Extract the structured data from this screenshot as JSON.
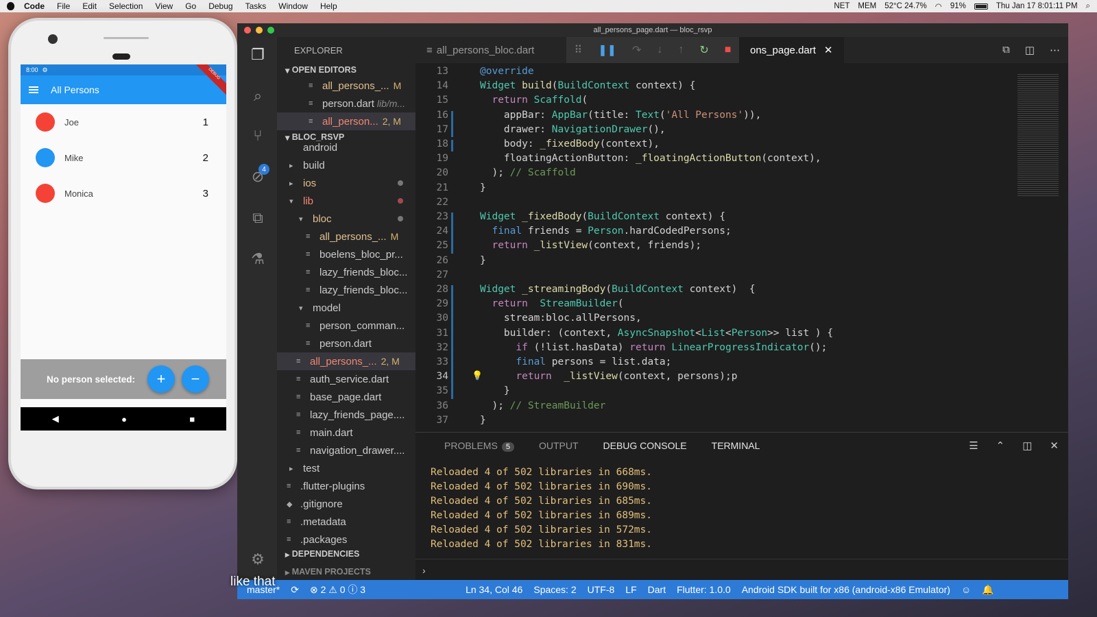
{
  "menubar": {
    "app": "Code",
    "items": [
      "File",
      "Edit",
      "Selection",
      "View",
      "Go",
      "Debug",
      "Tasks",
      "Window",
      "Help"
    ],
    "status": {
      "net": "NET",
      "mem": "MEM",
      "temp": "52°C 24.7%",
      "battery": "91%",
      "clock": "Thu Jan 17  8:01:11 PM"
    }
  },
  "phone": {
    "status_time": "8:00",
    "app_title": "All Persons",
    "persons": [
      {
        "name": "Joe",
        "num": "1",
        "color": "#f44336"
      },
      {
        "name": "Mike",
        "num": "2",
        "color": "#2196f3"
      },
      {
        "name": "Monica",
        "num": "3",
        "color": "#f44336"
      }
    ],
    "bottom_label": "No person selected:",
    "add_label": "+",
    "remove_label": "−"
  },
  "vscode": {
    "window_title": "all_persons_page.dart — bloc_rsvp",
    "explorer_title": "EXPLORER",
    "open_editors_title": "OPEN EDITORS",
    "project_title": "BLOC_RSVP",
    "dependencies_title": "DEPENDENCIES",
    "maven_title": "MAVEN PROJECTS",
    "open_editors": [
      {
        "label": "all_persons_...",
        "suffix": "M",
        "cls": "gold"
      },
      {
        "label": "person.dart",
        "suffix": "lib/m...",
        "cls": ""
      },
      {
        "label": "all_person...",
        "suffix": "2, M",
        "cls": "red"
      }
    ],
    "tree": [
      {
        "indent": 10,
        "icon": "",
        "label": "android",
        "cls": ""
      },
      {
        "indent": 10,
        "icon": "▸",
        "label": "build",
        "cls": ""
      },
      {
        "indent": 10,
        "icon": "▸",
        "label": "ios",
        "cls": "gold",
        "dot": true
      },
      {
        "indent": 10,
        "icon": "▾",
        "label": "lib",
        "cls": "red",
        "dot": true
      },
      {
        "indent": 24,
        "icon": "▾",
        "label": "bloc",
        "cls": "gold",
        "dot": true
      },
      {
        "indent": 34,
        "icon": "≡",
        "label": "all_persons_...",
        "cls": "gold",
        "mod": "M"
      },
      {
        "indent": 34,
        "icon": "≡",
        "label": "boelens_bloc_pr...",
        "cls": ""
      },
      {
        "indent": 34,
        "icon": "≡",
        "label": "lazy_friends_bloc...",
        "cls": ""
      },
      {
        "indent": 34,
        "icon": "≡",
        "label": "lazy_friends_bloc...",
        "cls": ""
      },
      {
        "indent": 24,
        "icon": "▾",
        "label": "model",
        "cls": ""
      },
      {
        "indent": 34,
        "icon": "≡",
        "label": "person_comman...",
        "cls": ""
      },
      {
        "indent": 34,
        "icon": "≡",
        "label": "person.dart",
        "cls": ""
      },
      {
        "indent": 20,
        "icon": "≡",
        "label": "all_persons_...",
        "cls": "red",
        "mod": "2, M",
        "sel": true
      },
      {
        "indent": 20,
        "icon": "≡",
        "label": "auth_service.dart",
        "cls": ""
      },
      {
        "indent": 20,
        "icon": "≡",
        "label": "base_page.dart",
        "cls": ""
      },
      {
        "indent": 20,
        "icon": "≡",
        "label": "lazy_friends_page....",
        "cls": ""
      },
      {
        "indent": 20,
        "icon": "≡",
        "label": "main.dart",
        "cls": ""
      },
      {
        "indent": 20,
        "icon": "≡",
        "label": "navigation_drawer....",
        "cls": ""
      },
      {
        "indent": 10,
        "icon": "▸",
        "label": "test",
        "cls": ""
      },
      {
        "indent": 6,
        "icon": "≡",
        "label": ".flutter-plugins",
        "cls": ""
      },
      {
        "indent": 6,
        "icon": "◆",
        "label": ".gitignore",
        "cls": ""
      },
      {
        "indent": 6,
        "icon": "≡",
        "label": ".metadata",
        "cls": ""
      },
      {
        "indent": 6,
        "icon": "≡",
        "label": ".packages",
        "cls": ""
      }
    ],
    "tabs": {
      "first": "all_persons_bloc.dart",
      "active": "ons_page.dart"
    },
    "code_lines": [
      {
        "n": "13",
        "html": "<span class='ann'>@override</span>"
      },
      {
        "n": "14",
        "html": "<span class='ty'>Widget</span> <span class='fn'>build</span>(<span class='ty'>BuildContext</span> context) {"
      },
      {
        "n": "15",
        "html": "  <span class='kwc'>return</span> <span class='ty'>Scaffold</span>("
      },
      {
        "n": "16",
        "html": "    appBar: <span class='ty'>AppBar</span>(title: <span class='ty'>Text</span>(<span class='st'>'All Persons'</span>)),"
      },
      {
        "n": "17",
        "html": "    drawer: <span class='ty'>NavigationDrawer</span>(),"
      },
      {
        "n": "18",
        "html": "    body: <span class='fn'>_fixedBody</span>(context),"
      },
      {
        "n": "19",
        "html": "    floatingActionButton: <span class='fn'>_floatingActionButton</span>(context),"
      },
      {
        "n": "20",
        "html": "  ); <span class='cm'>// Scaffold</span>"
      },
      {
        "n": "21",
        "html": "}"
      },
      {
        "n": "22",
        "html": ""
      },
      {
        "n": "23",
        "html": "<span class='ty'>Widget</span> <span class='fn'>_fixedBody</span>(<span class='ty'>BuildContext</span> context) {"
      },
      {
        "n": "24",
        "html": "  <span class='kw'>final</span> friends = <span class='ty'>Person</span>.hardCodedPersons;"
      },
      {
        "n": "25",
        "html": "  <span class='kwc'>return</span> <span class='fn'>_listView</span>(context, friends);"
      },
      {
        "n": "26",
        "html": "}"
      },
      {
        "n": "27",
        "html": ""
      },
      {
        "n": "28",
        "html": "<span class='ty'>Widget</span> <span class='fn'>_streamingBody</span>(<span class='ty'>BuildContext</span> context)  {"
      },
      {
        "n": "29",
        "html": "  <span class='kwc'>return</span>  <span class='ty'>StreamBuilder</span>("
      },
      {
        "n": "30",
        "html": "    stream:bloc.allPersons,"
      },
      {
        "n": "31",
        "html": "    builder: (context, <span class='ty'>AsyncSnapshot</span>&lt;<span class='ty'>List</span>&lt;<span class='ty'>Person</span>&gt;&gt; list ) {"
      },
      {
        "n": "32",
        "html": "      <span class='kwc'>if</span> (!list.hasData) <span class='kwc'>return</span> <span class='ty'>LinearProgressIndicator</span>();"
      },
      {
        "n": "33",
        "html": "      <span class='kw'>final</span> persons = list.data;"
      },
      {
        "n": "34",
        "html": "      <span class='kwc'>return</span>  <span class='fn'>_listView</span>(context, persons);p"
      },
      {
        "n": "35",
        "html": "    }"
      },
      {
        "n": "36",
        "html": "  ); <span class='cm'>// StreamBuilder</span>"
      },
      {
        "n": "37",
        "html": "}"
      }
    ],
    "panel": {
      "problems": "PROBLEMS",
      "problems_count": "5",
      "output": "OUTPUT",
      "debug_console": "DEBUG CONSOLE",
      "terminal": "TERMINAL",
      "lines": [
        "Reloaded 4 of 502 libraries in 668ms.",
        "Reloaded 4 of 502 libraries in 690ms.",
        "Reloaded 4 of 502 libraries in 685ms.",
        "Reloaded 4 of 502 libraries in 689ms.",
        "Reloaded 4 of 502 libraries in 572ms.",
        "Reloaded 4 of 502 libraries in 831ms."
      ]
    },
    "statusbar": {
      "branch": "master*",
      "problems": "⊗ 2 ⚠ 0 ⓘ 3",
      "position": "Ln 34, Col 46",
      "spaces": "Spaces: 2",
      "encoding": "UTF-8",
      "eol": "LF",
      "lang": "Dart",
      "flutter": "Flutter: 1.0.0",
      "device": "Android SDK built for x86 (android-x86 Emulator)"
    },
    "scm_badge": "4"
  },
  "caption": "like that"
}
